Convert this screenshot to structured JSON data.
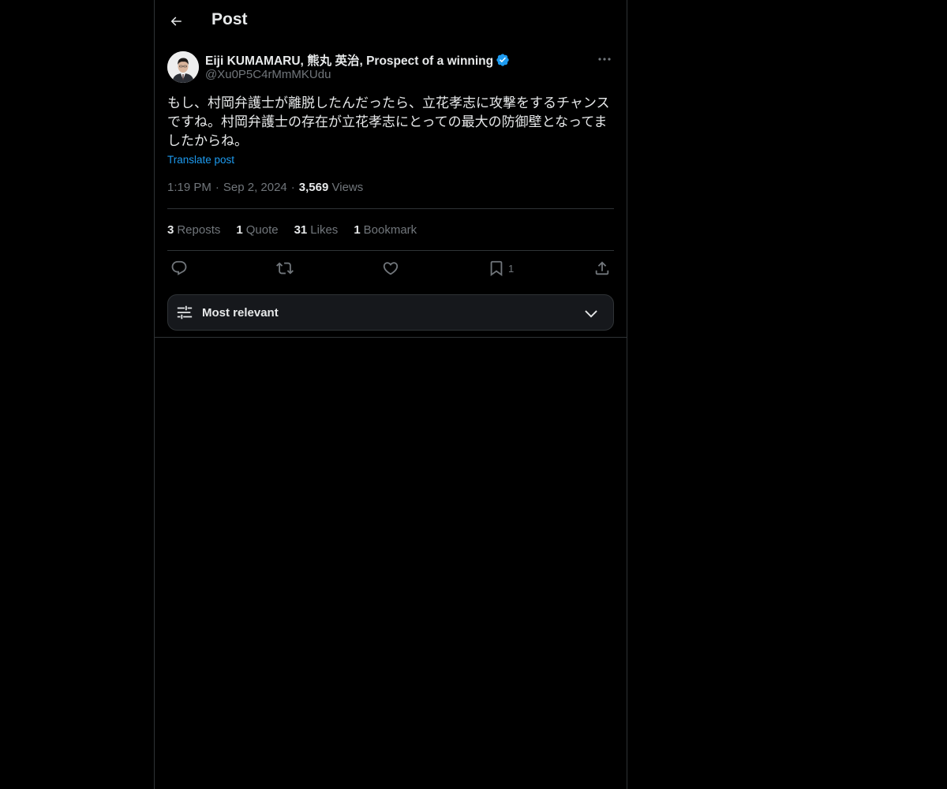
{
  "header": {
    "title": "Post",
    "back_icon": "arrow-left-icon"
  },
  "post": {
    "author": {
      "display_name": "Eiji KUMAMARU, 熊丸 英治, Prospect of a winning",
      "handle": "@Xu0P5C4rMmMKUdu",
      "verified": true
    },
    "text": "もし、村岡弁護士が離脱したんだったら、立花孝志に攻撃をするチャンスですね。村岡弁護士の存在が立花孝志にとっての最大の防御壁となってましたからね。",
    "translate_label": "Translate post",
    "time": "1:19 PM",
    "date": "Sep 2, 2024",
    "views_count": "3,569",
    "views_label": "Views",
    "dot": "·"
  },
  "stats": [
    {
      "count": "3",
      "label": "Reposts"
    },
    {
      "count": "1",
      "label": "Quote"
    },
    {
      "count": "31",
      "label": "Likes"
    },
    {
      "count": "1",
      "label": "Bookmark"
    }
  ],
  "actions": {
    "reply_icon": "reply-icon",
    "repost_icon": "repost-icon",
    "like_icon": "heart-icon",
    "bookmark_icon": "bookmark-icon",
    "bookmark_count": "1",
    "share_icon": "share-icon"
  },
  "sort": {
    "label": "Most relevant"
  },
  "colors": {
    "background": "#000000",
    "text": "#e7e9ea",
    "muted": "#71767b",
    "accent": "#1d9bf0",
    "border": "#2f3336"
  }
}
